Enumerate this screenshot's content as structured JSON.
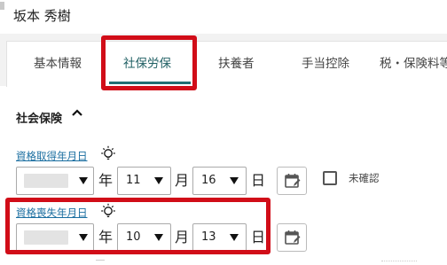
{
  "header": {
    "employee_name": "坂本 秀樹"
  },
  "tabs": [
    {
      "label": "基本情報",
      "active": false
    },
    {
      "label": "社保労保",
      "active": true
    },
    {
      "label": "扶養者",
      "active": false
    },
    {
      "label": "手当控除",
      "active": false
    },
    {
      "label": "税・保険料等",
      "active": false
    }
  ],
  "section": {
    "title": "社会保険",
    "caret": "chevron-up-icon"
  },
  "acquisition_date": {
    "label": "資格取得年月日",
    "hint_icon": "lightbulb-icon",
    "year_value": "",
    "year_unit": "年",
    "month_value": "11",
    "month_unit": "月",
    "day_value": "16",
    "day_unit": "日",
    "calendar_icon": "calendar-edit-icon",
    "unconfirmed_label": "未確認",
    "unconfirmed_checked": false
  },
  "loss_date": {
    "label": "資格喪失年月日",
    "hint_icon": "lightbulb-icon",
    "year_value": "",
    "year_unit": "年",
    "month_value": "10",
    "month_unit": "月",
    "day_value": "13",
    "day_unit": "日",
    "calendar_icon": "calendar-edit-icon"
  },
  "colors": {
    "link": "#1a6ea0",
    "active_tab_underline": "#1f6e73",
    "highlight_frame": "#d10d18"
  }
}
